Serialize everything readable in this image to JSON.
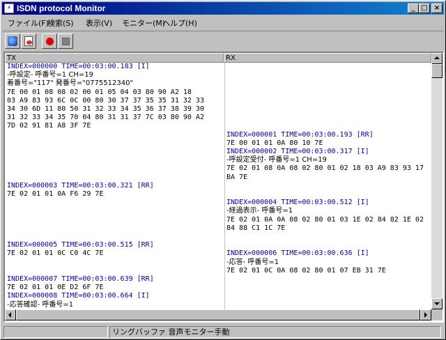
{
  "window": {
    "title": "ISDN protocol Monitor",
    "app_icon_glyph": "⚡",
    "minimize_glyph": "_",
    "maximize_glyph": "□",
    "close_glyph": "×"
  },
  "menu": [
    "ファイル(F)",
    "検索(S)",
    "表示(V)",
    "モニター(M)",
    "ヘルプ(H)"
  ],
  "toolbar": [
    {
      "icon": "monitor-icon"
    },
    {
      "icon": "document-icon"
    },
    {
      "icon": "record-icon",
      "color": "#e00000"
    },
    {
      "icon": "stop-icon",
      "color": "#808080"
    }
  ],
  "columns": {
    "tx": "TX",
    "rx": "RX"
  },
  "colors": {
    "header_text": "#0000a8",
    "title_bar": "#000080"
  },
  "tx": [
    {
      "lines": [
        {
          "kind": "hdr",
          "text": "INDEX=000000 TIME=00:03:00.183 [I]"
        },
        {
          "kind": "txt",
          "text": "-呼設定- 呼番号=1 CH=19"
        },
        {
          "kind": "txt",
          "text": "着番号=\"117\" 発番号=\"0775512340\""
        },
        {
          "kind": "hex",
          "text": "7E 00 01 08 08 02 00 01 05 04 03 80 90 A2 18"
        },
        {
          "kind": "hex",
          "text": "03 A9 83 93 6C 0C 00 80 30 37 37 35 35 31 32 33"
        },
        {
          "kind": "hex",
          "text": "34 30 6D 11 80 50 31 32 33 34 35 36 37 38 39 30"
        },
        {
          "kind": "hex",
          "text": "31 32 33 34 35 70 04 80 31 31 37 7C 03 80 90 A2"
        },
        {
          "kind": "hex",
          "text": "7D 02 91 81 A8 3F 7E"
        }
      ]
    },
    {
      "lines": [
        {
          "kind": "hdr",
          "text": "INDEX=000003 TIME=00:03:00.321 [RR]"
        },
        {
          "kind": "hex",
          "text": "7E 02 01 01 0A F6 29 7E"
        }
      ]
    },
    {
      "lines": [
        {
          "kind": "hdr",
          "text": "INDEX=000005 TIME=00:03:00.515 [RR]"
        },
        {
          "kind": "hex",
          "text": "7E 02 01 01 0C C0 4C 7E"
        }
      ]
    },
    {
      "lines": [
        {
          "kind": "hdr",
          "text": "INDEX=000007 TIME=00:03:00.639 [RR]"
        },
        {
          "kind": "hex",
          "text": "7E 02 01 01 0E D2 6F 7E"
        },
        {
          "kind": "hdr",
          "text": "INDEX=000008 TIME=00:03:00.664 [I]"
        },
        {
          "kind": "txt",
          "text": "-応答確認- 呼番号=1"
        }
      ]
    }
  ],
  "rx": [
    {
      "lines": [
        {
          "kind": "hdr",
          "text": "INDEX=000001 TIME=00:03:00.193 [RR]"
        },
        {
          "kind": "hex",
          "text": "7E 00 01 01 0A 80 10 7E"
        },
        {
          "kind": "hdr",
          "text": "INDEX=000002 TIME=00:03:00.317 [I]"
        },
        {
          "kind": "txt",
          "text": "-呼設定受付- 呼番号=1 CH=19"
        },
        {
          "kind": "hex",
          "text": "7E 02 01 08 0A 08 02 80 01 02 18 03 A9 83 93 17"
        },
        {
          "kind": "hex",
          "text": "BA 7E"
        }
      ]
    },
    {
      "lines": [
        {
          "kind": "hdr",
          "text": "INDEX=000004 TIME=00:03:00.512 [I]"
        },
        {
          "kind": "txt",
          "text": "-経過表示- 呼番号=1"
        },
        {
          "kind": "hex",
          "text": "7E 02 01 0A 0A 08 02 80 01 03 1E 02 84 82 1E 02"
        },
        {
          "kind": "hex",
          "text": "84 88 C1 1C 7E"
        }
      ]
    },
    {
      "lines": [
        {
          "kind": "hdr",
          "text": "INDEX=000006 TIME=00:03:00.636 [I]"
        },
        {
          "kind": "txt",
          "text": "-応答- 呼番号=1"
        },
        {
          "kind": "hex",
          "text": "7E 02 01 0C 0A 08 02 80 01 07 EB 31 7E"
        }
      ]
    }
  ],
  "status": {
    "pane1": "",
    "pane2": "リングバッファ 音声モニター手動"
  }
}
